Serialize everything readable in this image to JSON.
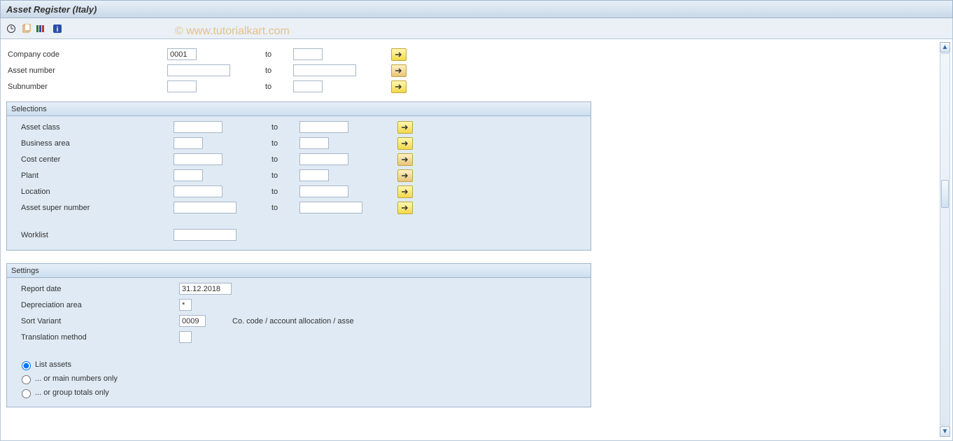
{
  "title": "Asset Register (Italy)",
  "watermark": "© www.tutorialkart.com",
  "icons": {
    "clock": "clock-icon",
    "export": "export-icon",
    "variant": "variant-icon",
    "info": "info-icon"
  },
  "header": {
    "company_code": {
      "label": "Company code",
      "from": "0001",
      "to_label": "to",
      "to": ""
    },
    "asset_number": {
      "label": "Asset number",
      "from": "",
      "to_label": "to",
      "to": ""
    },
    "subnumber": {
      "label": "Subnumber",
      "from": "",
      "to_label": "to",
      "to": ""
    }
  },
  "selections": {
    "title": "Selections",
    "rows": {
      "asset_class": {
        "label": "Asset class",
        "from": "",
        "to_label": "to",
        "to": ""
      },
      "business_area": {
        "label": "Business area",
        "from": "",
        "to_label": "to",
        "to": ""
      },
      "cost_center": {
        "label": "Cost center",
        "from": "",
        "to_label": "to",
        "to": ""
      },
      "plant": {
        "label": "Plant",
        "from": "",
        "to_label": "to",
        "to": ""
      },
      "location": {
        "label": "Location",
        "from": "",
        "to_label": "to",
        "to": ""
      },
      "asset_super": {
        "label": "Asset super number",
        "from": "",
        "to_label": "to",
        "to": ""
      }
    },
    "worklist": {
      "label": "Worklist",
      "value": ""
    }
  },
  "settings": {
    "title": "Settings",
    "report_date": {
      "label": "Report date",
      "value": "31.12.2018"
    },
    "depr_area": {
      "label": "Depreciation area",
      "value": "*"
    },
    "sort_variant": {
      "label": "Sort Variant",
      "value": "0009",
      "hint": "Co. code / account allocation / asse"
    },
    "translation": {
      "label": "Translation method",
      "value": ""
    },
    "radios": {
      "list_assets": "List assets",
      "main_only": "... or main numbers only",
      "group_only": "... or group totals only"
    }
  }
}
